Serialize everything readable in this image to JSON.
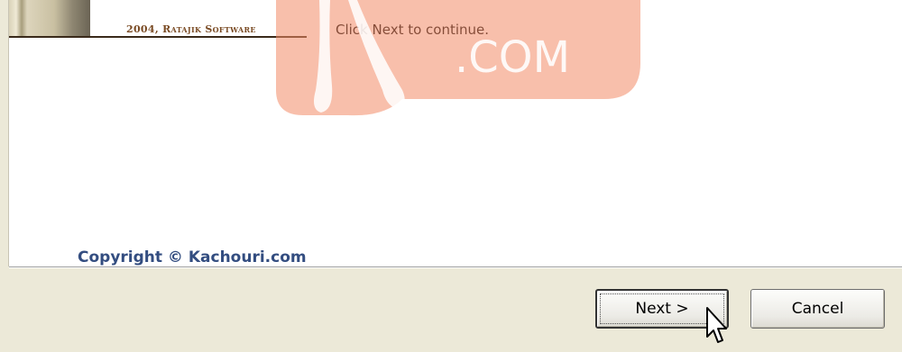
{
  "installer": {
    "banner_credit": "2004, Ratajik Software",
    "instruction": "Click Next to continue.",
    "copyright": "Copyright © Kachouri.com",
    "watermark_text": "Kachouri .com"
  },
  "buttons": {
    "next_label": "Next >",
    "cancel_label": "Cancel"
  },
  "colors": {
    "dialog_background": "#ece9d8",
    "copyright_text": "#334d80",
    "banner_text": "#7a4b24",
    "watermark": "#f28b66"
  }
}
